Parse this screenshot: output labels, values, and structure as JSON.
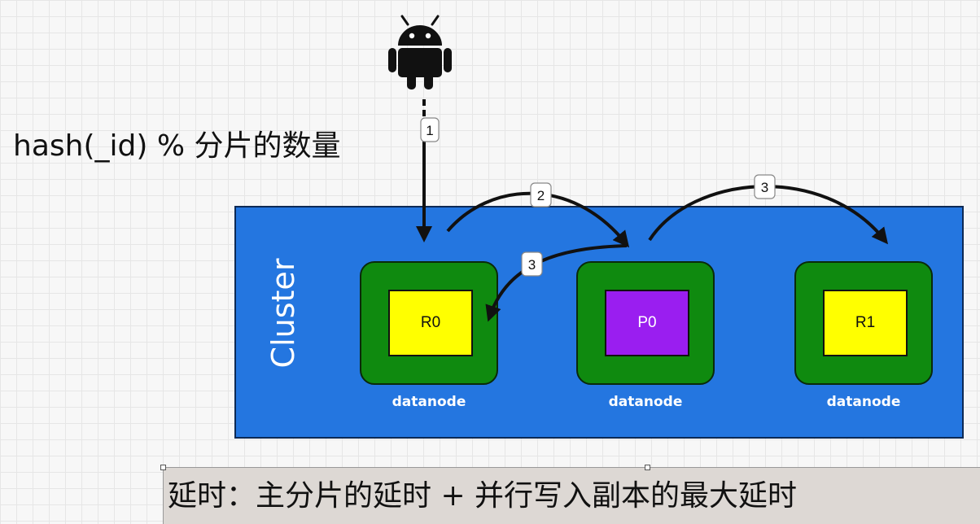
{
  "formula": "hash(_id) % 分片的数量",
  "cluster": {
    "label": "Cluster"
  },
  "nodes": [
    {
      "shard": "R0",
      "label": "datanode",
      "type": "replica",
      "color": "#ffff00"
    },
    {
      "shard": "P0",
      "label": "datanode",
      "type": "primary",
      "color": "#9a1ef0"
    },
    {
      "shard": "R1",
      "label": "datanode",
      "type": "replica",
      "color": "#ffff00"
    }
  ],
  "steps": [
    {
      "label": "1",
      "from": "client",
      "to": "R0"
    },
    {
      "label": "2",
      "from": "R0",
      "to": "P0"
    },
    {
      "label": "3",
      "from": "P0",
      "to": "R0"
    },
    {
      "label": "3",
      "from": "P0",
      "to": "R1"
    }
  ],
  "client": {
    "icon": "android-icon"
  },
  "note": "延时：主分片的延时 + 并行写入副本的最大延时",
  "colors": {
    "cluster": "#2476e0",
    "node": "#0f8a0f",
    "replica": "#ffff00",
    "primary": "#9a1ef0",
    "android": "#111111"
  }
}
